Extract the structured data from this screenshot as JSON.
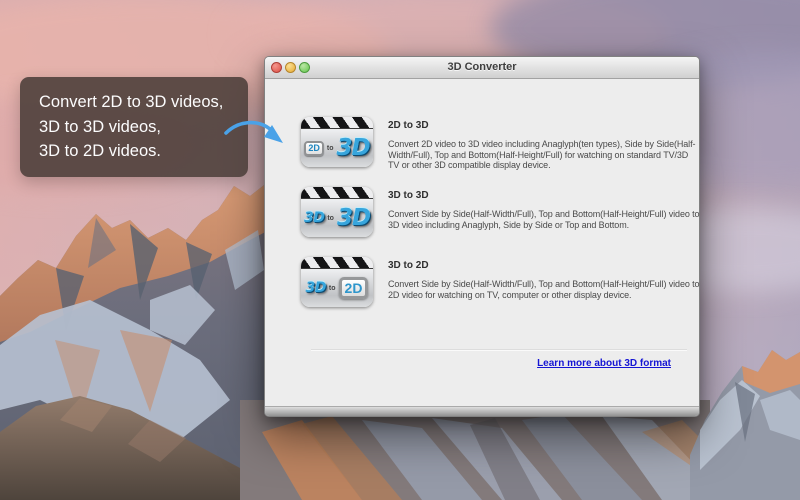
{
  "desktop": {
    "tooltip": {
      "lines": [
        "Convert 2D to 3D videos,",
        "3D to 3D videos,",
        "3D to 2D videos."
      ]
    }
  },
  "window": {
    "title": "3D Converter",
    "controls": [
      "close",
      "minimize",
      "zoom"
    ],
    "items": [
      {
        "title": "2D to 3D",
        "description": "Convert 2D video to 3D video including Anaglyph(ten types), Side by Side(Half-Width/Full), Top and Bottom(Half-Height/Full) for watching on standard TV/3D TV or other 3D compatible display device.",
        "icon": {
          "from": "2D",
          "connector": "to",
          "to": "3D"
        }
      },
      {
        "title": "3D to 3D",
        "description": "Convert Side by Side(Half-Width/Full), Top and Bottom(Half-Height/Full) video to 3D video including Anaglyph, Side by Side or Top and Bottom.",
        "icon": {
          "from": "3D",
          "connector": "to",
          "to": "3D"
        }
      },
      {
        "title": "3D to 2D",
        "description": "Convert Side by Side(Half-Width/Full), Top and Bottom(Half-Height/Full) video to 2D video for watching on TV, computer or other display device.",
        "icon": {
          "from": "3D",
          "connector": "to",
          "to": "2D"
        }
      }
    ],
    "footer": {
      "link_label": "Learn more about 3D format"
    }
  },
  "colors": {
    "link_blue": "#1515d4",
    "arrow_blue": "#4aa2e8",
    "icon_text_blue": "#2e96cc",
    "tooltip_bg": "rgba(72,60,55,0.87)",
    "window_bg": "#ededed"
  }
}
